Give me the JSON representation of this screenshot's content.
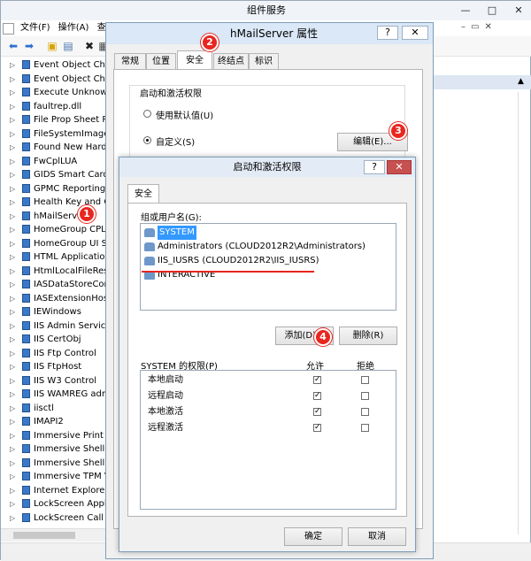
{
  "main": {
    "title": "组件服务",
    "menu": [
      "文件(F)",
      "操作(A)",
      "查"
    ],
    "controls": {
      "min": "—",
      "max": "□",
      "close": "✕"
    },
    "tree": [
      "Event Object Chan",
      "Event Object Chan",
      "Execute Unknown",
      "faultrep.dll",
      "File Prop Sheet Pa",
      "FileSystemImage",
      "Found New Hardw",
      "FwCplLUA",
      "GIDS Smart Card",
      "GPMC Reporting",
      "Health Key and Ce",
      "hMailServe",
      "HomeGroup CPL A",
      "HomeGroup UI St",
      "HTML Application",
      "HtmlLocalFileReso",
      "IASDataStoreCom",
      "IASExtensionHost",
      "IEWindows",
      "IIS Admin Service",
      "IIS CertObj",
      "IIS Ftp Control",
      "IIS FtpHost",
      "IIS W3 Control",
      "IIS WAMREG adm",
      "iisctl",
      "IMAPI2",
      "Immersive Print D",
      "Immersive Shell",
      "Immersive Shell B",
      "Immersive TPM Vi",
      "Internet Explorer A",
      "LockScreen Applicati",
      "LockScreen Call Broke"
    ]
  },
  "dialog1": {
    "title": "hMailServer 属性",
    "help": "?",
    "close": "✕",
    "tabs": [
      "常规",
      "位置",
      "安全",
      "终结点",
      "标识"
    ],
    "group_label": "启动和激活权限",
    "radio_default": "使用默认值(U)",
    "radio_custom": "自定义(S)",
    "edit_button": "编辑(E)..."
  },
  "dialog2": {
    "title": "启动和激活权限",
    "help": "?",
    "close": "✕",
    "tab": "安全",
    "users_label": "组或用户名(G):",
    "users": [
      "SYSTEM",
      "Administrators (CLOUD2012R2\\Administrators)",
      "IIS_IUSRS (CLOUD2012R2\\IIS_IUSRS)",
      "INTERACTIVE"
    ],
    "add_button": "添加(D)...",
    "remove_button": "删除(R)",
    "perm_label": "SYSTEM 的权限(P)",
    "allow": "允许",
    "deny": "拒绝",
    "permissions": [
      {
        "name": "本地启动",
        "allow": true,
        "deny": false
      },
      {
        "name": "远程启动",
        "allow": true,
        "deny": false
      },
      {
        "name": "本地激活",
        "allow": true,
        "deny": false
      },
      {
        "name": "远程激活",
        "allow": true,
        "deny": false
      }
    ],
    "ok_button": "确定",
    "cancel_button": "取消"
  },
  "badges": [
    "1",
    "2",
    "3",
    "4"
  ],
  "colors": {
    "badge": "#e8261f",
    "selected": "#3399ff",
    "underline": "#e8261f"
  }
}
